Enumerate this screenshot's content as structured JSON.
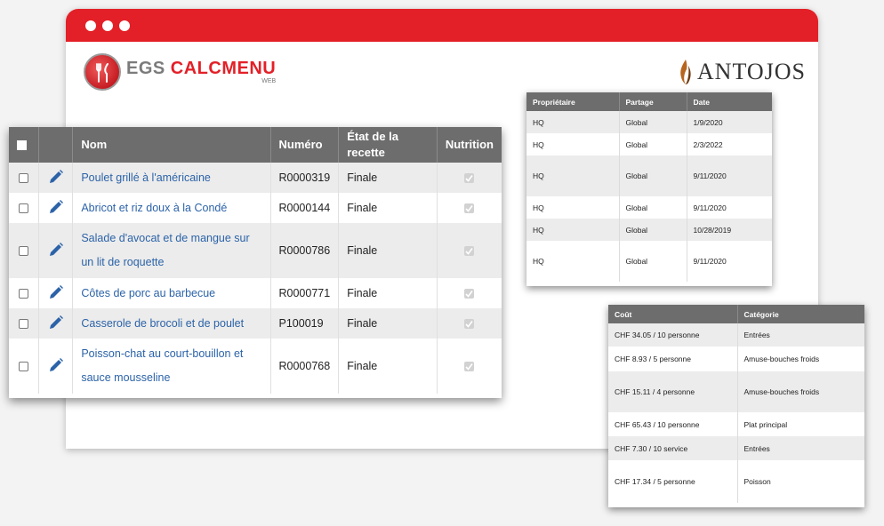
{
  "brand_left": {
    "part1": "EGS ",
    "part2": "CALCMENU",
    "sub": "WEB"
  },
  "brand_right": {
    "name": "ANTOJOS"
  },
  "colors": {
    "browser_bar": "#e32027",
    "header_bg": "#6d6d6d",
    "link": "#2c63a8"
  },
  "recipes": {
    "headers": {
      "name": "Nom",
      "number": "Numéro",
      "state": "État de la recette",
      "nutrition": "Nutrition"
    },
    "rows": [
      {
        "name": "Poulet grillé à l'américaine",
        "number": "R0000319",
        "state": "Finale"
      },
      {
        "name": "Abricot et riz doux à la Condé",
        "number": "R0000144",
        "state": "Finale"
      },
      {
        "name": "Salade d'avocat et de mangue sur un lit de roquette",
        "number": "R0000786",
        "state": "Finale"
      },
      {
        "name": "Côtes de porc au barbecue",
        "number": "R0000771",
        "state": "Finale"
      },
      {
        "name": "Casserole de brocoli et de poulet",
        "number": "P100019",
        "state": "Finale"
      },
      {
        "name": "Poisson-chat au court-bouillon et sauce mousseline",
        "number": "R0000768",
        "state": "Finale"
      }
    ]
  },
  "owners": {
    "headers": {
      "owner": "Propriétaire",
      "share": "Partage",
      "date": "Date"
    },
    "rows": [
      {
        "owner": "HQ",
        "share": "Global",
        "date": "1/9/2020"
      },
      {
        "owner": "HQ",
        "share": "Global",
        "date": "2/3/2022"
      },
      {
        "owner": "HQ",
        "share": "Global",
        "date": "9/11/2020"
      },
      {
        "owner": "HQ",
        "share": "Global",
        "date": "9/11/2020"
      },
      {
        "owner": "HQ",
        "share": "Global",
        "date": "10/28/2019"
      },
      {
        "owner": "HQ",
        "share": "Global",
        "date": "9/11/2020"
      }
    ]
  },
  "costs": {
    "headers": {
      "cost": "Coût",
      "category": "Catégorie"
    },
    "rows": [
      {
        "cost": "CHF 34.05 / 10 personne",
        "category": "Entrées"
      },
      {
        "cost": "CHF 8.93 / 5 personne",
        "category": "Amuse-bouches froids"
      },
      {
        "cost": "CHF 15.11 / 4 personne",
        "category": "Amuse-bouches froids"
      },
      {
        "cost": "CHF 65.43 / 10 personne",
        "category": "Plat principal"
      },
      {
        "cost": "CHF 7.30 / 10 service",
        "category": "Entrées"
      },
      {
        "cost": "CHF 17.34 / 5 personne",
        "category": "Poisson"
      }
    ]
  }
}
